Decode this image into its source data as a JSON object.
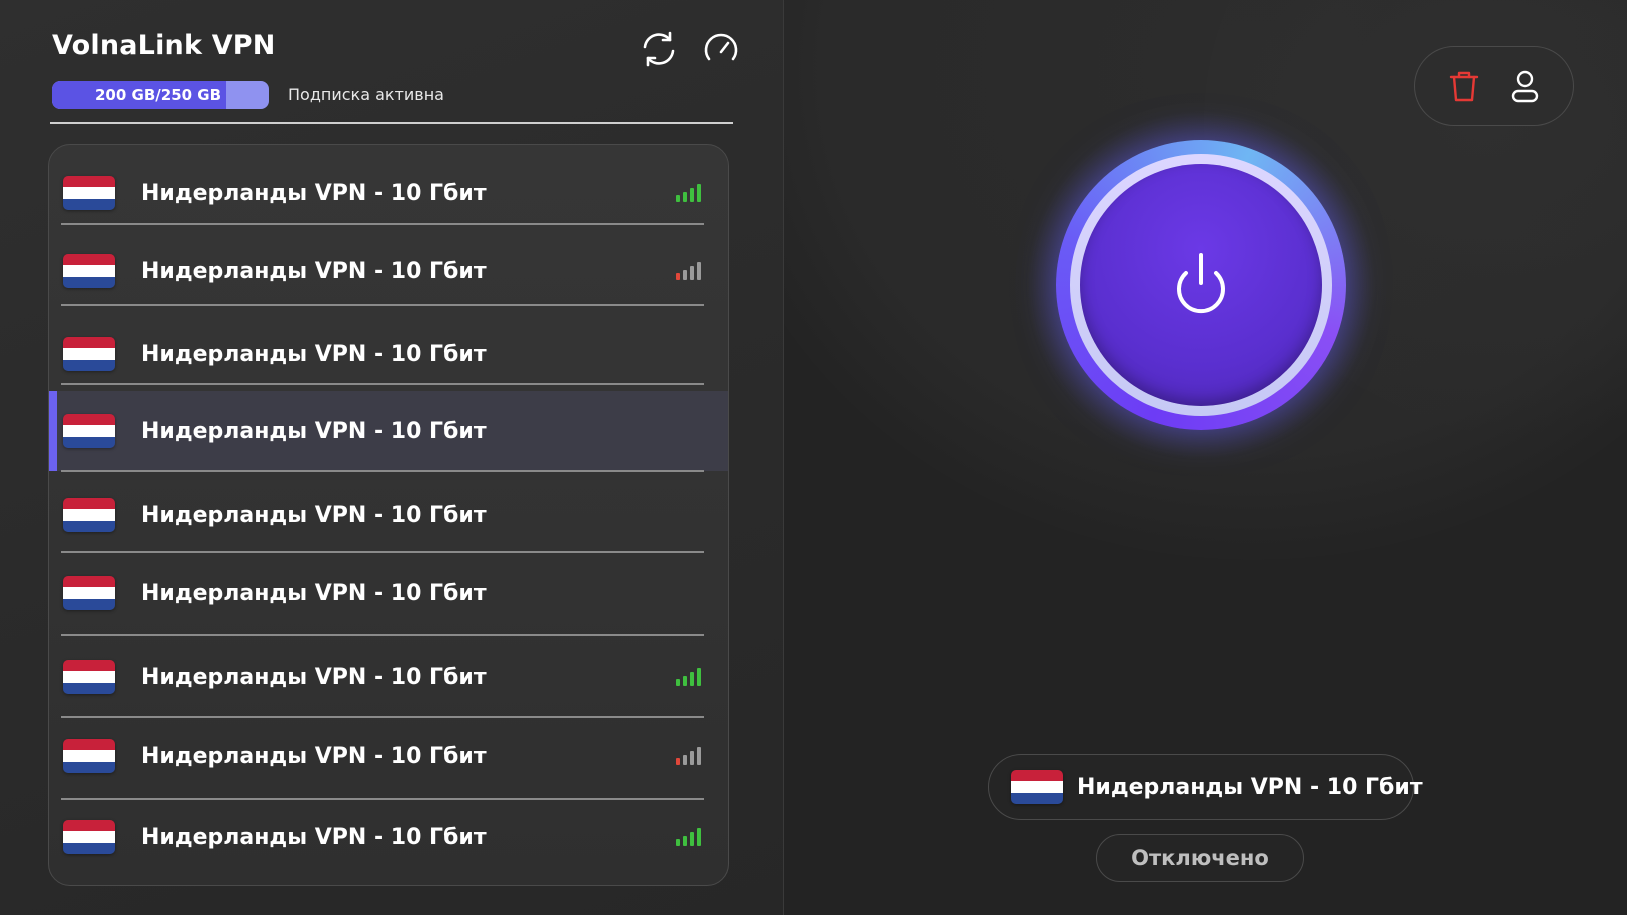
{
  "app": {
    "title": "VolnaLink VPN"
  },
  "header": {
    "usage_label": "200 GB/250 GB",
    "usage_fraction": 0.8,
    "subscription_status": "Подписка активна",
    "refresh_icon": "refresh-icon",
    "speed_icon": "speedometer-icon"
  },
  "servers": [
    {
      "name": "Нидерланды VPN - 10 Гбит",
      "signal": "strong",
      "selected": false
    },
    {
      "name": "Нидерланды VPN - 10 Гбит",
      "signal": "weak",
      "selected": false
    },
    {
      "name": "Нидерланды VPN - 10 Гбит",
      "signal": "none",
      "selected": false
    },
    {
      "name": "Нидерланды VPN - 10 Гбит",
      "signal": "none",
      "selected": true
    },
    {
      "name": "Нидерланды VPN - 10 Гбит",
      "signal": "none",
      "selected": false
    },
    {
      "name": "Нидерланды VPN - 10 Гбит",
      "signal": "none",
      "selected": false
    },
    {
      "name": "Нидерланды VPN - 10 Гбит",
      "signal": "strong",
      "selected": false
    },
    {
      "name": "Нидерланды VPN - 10 Гбит",
      "signal": "weak",
      "selected": false
    },
    {
      "name": "Нидерланды VPN - 10 Гбит",
      "signal": "strong",
      "selected": false
    }
  ],
  "right": {
    "trash_icon": "trash-icon",
    "profile_icon": "user-icon",
    "power_icon": "power-icon",
    "current_server": "Нидерланды VPN - 10 Гбит",
    "status": "Отключено"
  },
  "colors": {
    "accent": "#6c62f0",
    "signal_green": "#3fbf3f",
    "signal_red": "#e0473a",
    "signal_gray": "#9a9a9a",
    "trash_red": "#e53935"
  }
}
